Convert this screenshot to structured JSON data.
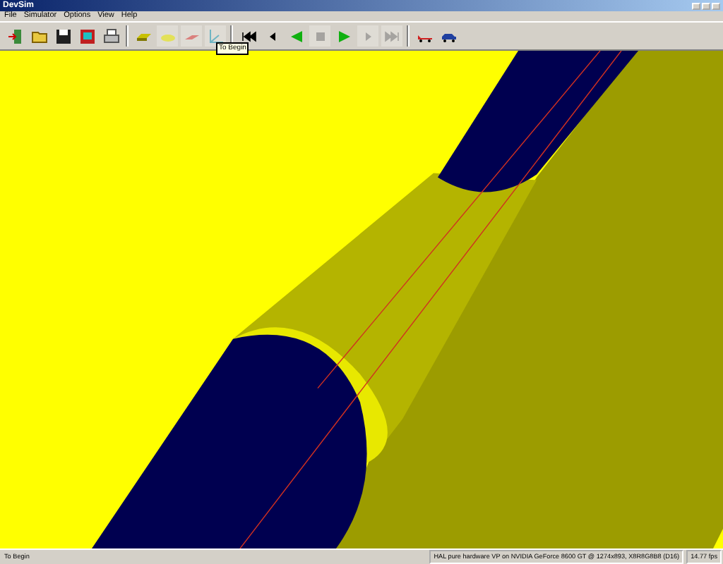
{
  "window": {
    "title": "DevSim"
  },
  "menu": [
    {
      "label": "File"
    },
    {
      "label": "Simulator"
    },
    {
      "label": "Options"
    },
    {
      "label": "View"
    },
    {
      "label": "Help"
    }
  ],
  "toolbar": [
    {
      "kind": "exit",
      "disabled": false
    },
    {
      "kind": "open",
      "disabled": false
    },
    {
      "kind": "save",
      "disabled": false
    },
    {
      "kind": "monitor",
      "disabled": false
    },
    {
      "kind": "print",
      "disabled": false
    },
    {
      "kind": "sep"
    },
    {
      "kind": "slab",
      "disabled": false
    },
    {
      "kind": "blob",
      "disabled": true
    },
    {
      "kind": "wedge",
      "disabled": true
    },
    {
      "kind": "axes",
      "disabled": true
    },
    {
      "kind": "sep"
    },
    {
      "kind": "begin",
      "disabled": false
    },
    {
      "kind": "stepback",
      "disabled": false
    },
    {
      "kind": "playback",
      "disabled": false
    },
    {
      "kind": "stop",
      "disabled": true
    },
    {
      "kind": "play",
      "disabled": false
    },
    {
      "kind": "stepfwd",
      "disabled": true
    },
    {
      "kind": "end",
      "disabled": true
    },
    {
      "kind": "sep"
    },
    {
      "kind": "redcar",
      "disabled": false
    },
    {
      "kind": "bluecar",
      "disabled": false
    }
  ],
  "tooltip": "To Begin",
  "status_bar": {
    "message": "To Begin",
    "renderer": "HAL pure hardware VP on NVIDIA GeForce 8600 GT @ 1274x893, X8R8G8B8 (D16)",
    "fps": "14.77 fps"
  }
}
